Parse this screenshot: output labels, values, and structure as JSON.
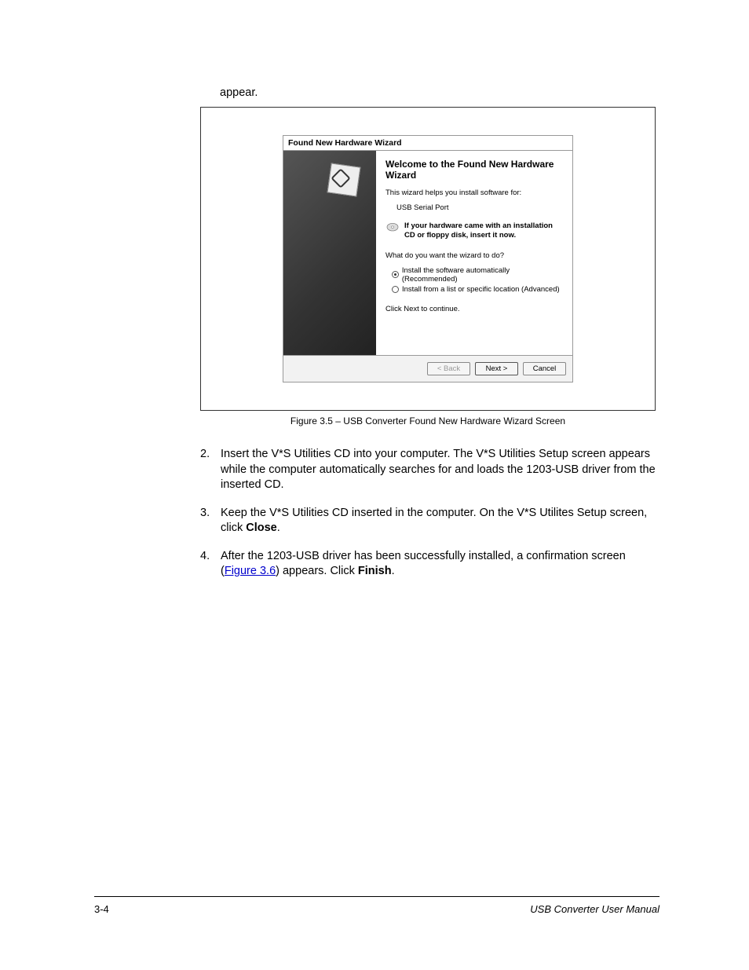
{
  "intro_fragment": "appear.",
  "wizard": {
    "window_title": "Found New Hardware Wizard",
    "heading": "Welcome to the Found New Hardware Wizard",
    "helps_text": "This wizard helps you install software for:",
    "device_name": "USB Serial Port",
    "cd_hint": "If your hardware came with an installation CD or floppy disk, insert it now.",
    "question": "What do you want the wizard to do?",
    "option_auto": "Install the software automatically (Recommended)",
    "option_list": "Install from a list or specific location (Advanced)",
    "continue_text": "Click Next to continue.",
    "back_btn": "< Back",
    "next_btn": "Next >",
    "cancel_btn": "Cancel"
  },
  "caption": "Figure 3.5 – USB Converter Found New Hardware Wizard Screen",
  "steps": {
    "s2_num": "2.",
    "s2_text": "Insert the V*S Utilities CD into your computer. The V*S Utilities Setup screen appears while the computer automatically searches for and loads the 1203-USB driver from the inserted CD.",
    "s3_num": "3.",
    "s3_pre": "Keep the V*S Utilities CD inserted in the computer. On the V*S Utilites Setup screen, click ",
    "s3_bold": "Close",
    "s3_post": ".",
    "s4_num": "4.",
    "s4_pre": "After the 1203-USB driver has been successfully installed, a confirmation screen (",
    "s4_link": "Figure 3.6",
    "s4_mid": ") appears. Click ",
    "s4_bold": "Finish",
    "s4_post": "."
  },
  "footer": {
    "page": "3-4",
    "doc": "USB Converter User Manual"
  }
}
